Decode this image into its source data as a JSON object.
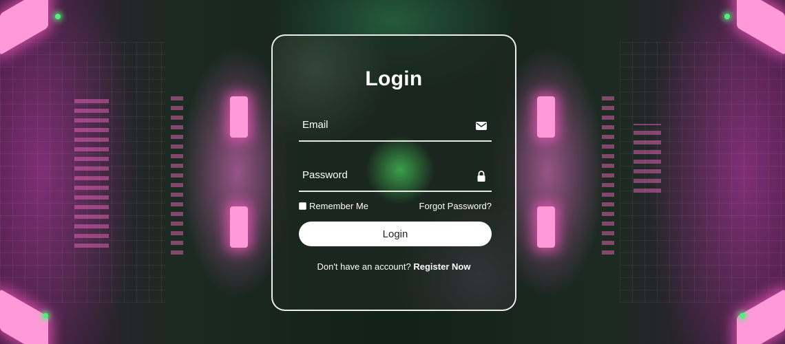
{
  "login_card": {
    "title": "Login",
    "email_label": "Email",
    "email_icon": "envelope-icon",
    "password_label": "Password",
    "password_icon": "lock-icon",
    "remember_me_label": "Remember Me",
    "remember_me_checked": false,
    "forgot_password_link": "Forgot Password?",
    "login_button_label": "Login",
    "register_prompt": "Don't have an account?",
    "register_link": "Register Now"
  },
  "colors": {
    "card_border": "#ffffff",
    "button_background": "#ffffff",
    "button_text": "#222222",
    "neon_accent": "#ff9ad8",
    "green_glow": "#46c85a"
  }
}
